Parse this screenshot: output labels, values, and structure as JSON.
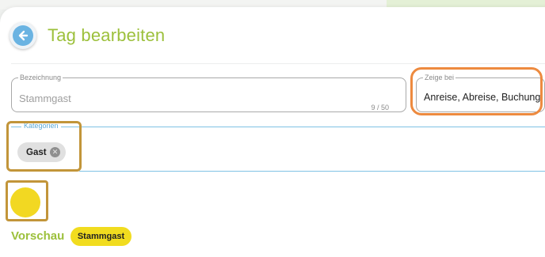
{
  "header": {
    "title": "Tag bearbeiten",
    "back_icon": "arrow-left-icon"
  },
  "form": {
    "bezeichnung": {
      "label": "Bezeichnung",
      "value": "Stammgast",
      "counter": "9 / 50"
    },
    "zeige_bei": {
      "label": "Zeige bei",
      "value": "Anreise, Abreise, Buchung"
    },
    "kategorien": {
      "label": "Kategorien",
      "chips": [
        {
          "label": "Gast"
        }
      ]
    },
    "color": "#f2d822"
  },
  "preview": {
    "label": "Vorschau",
    "badge": "Stammgast"
  },
  "colors": {
    "accent_green": "#9cc03b",
    "highlight_orange": "#ed8a3f",
    "highlight_gold": "#c2953a",
    "badge_yellow": "#f1dc1f"
  }
}
